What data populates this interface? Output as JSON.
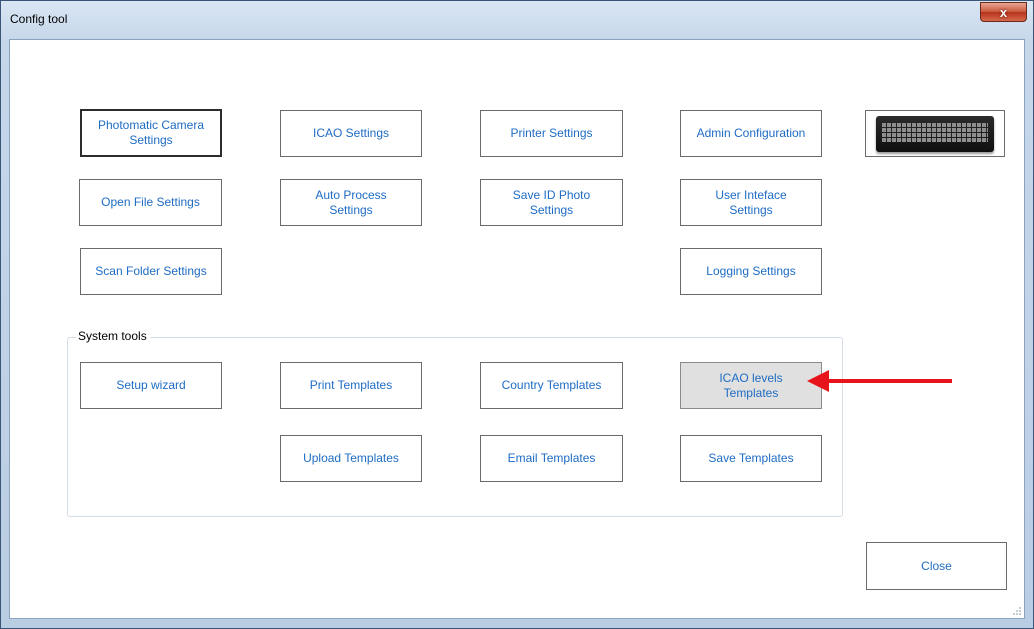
{
  "window": {
    "title": "Config tool",
    "close_glyph": "x"
  },
  "settings_buttons": {
    "photomatic_camera": "Photomatic Camera\nSettings",
    "icao": "ICAO Settings",
    "printer": "Printer Settings",
    "admin": "Admin Configuration",
    "open_file": "Open File Settings",
    "auto_process": "Auto Process\nSettings",
    "save_id_photo": "Save ID Photo\nSettings",
    "user_interface": "User Inteface\nSettings",
    "scan_folder": "Scan Folder Settings",
    "logging": "Logging Settings"
  },
  "keyboard_button": {
    "icon": "keyboard-icon"
  },
  "system_tools": {
    "label": "System tools",
    "setup_wizard": "Setup wizard",
    "print_templates": "Print Templates",
    "country_templates": "Country Templates",
    "icao_levels_templates": "ICAO levels\nTemplates",
    "upload_templates": "Upload Templates",
    "email_templates": "Email Templates",
    "save_templates": "Save Templates"
  },
  "close_button": "Close",
  "annotation": {
    "arrow_color": "#e8141b",
    "icon": "red-arrow-icon"
  }
}
